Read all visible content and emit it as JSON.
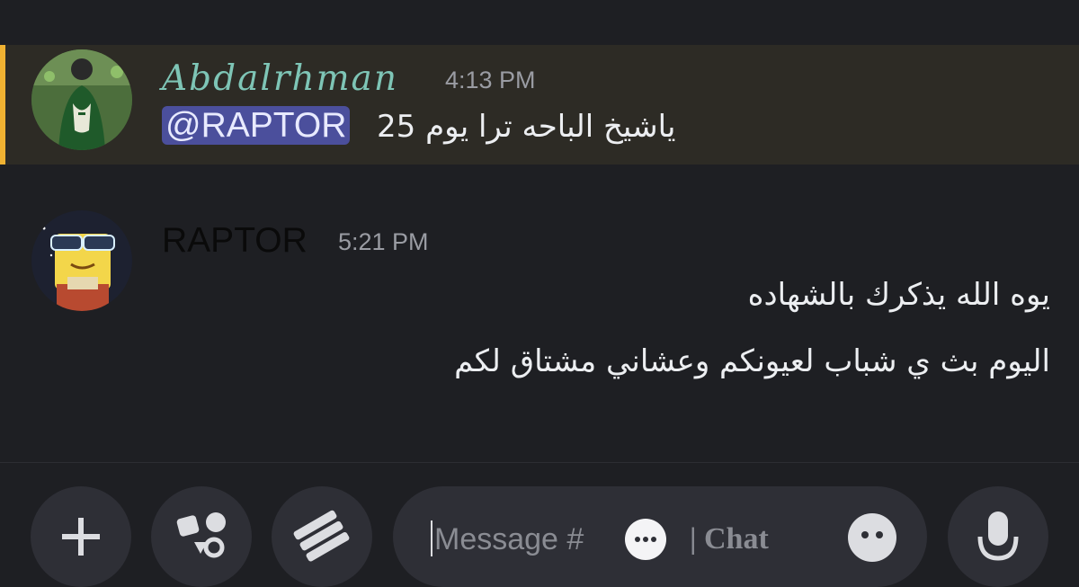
{
  "messages": [
    {
      "author": "Abdalrhman",
      "time": "4:13 PM",
      "mention": "@RAPTOR",
      "text": "ياشيخ الباحه ترا يوم 25",
      "highlighted": true
    },
    {
      "author": "RAPTOR",
      "time": "5:21 PM",
      "lines": [
        "يوه الله يذكرك بالشهاده",
        "اليوم بث ي شباب لعيونكم وعشاني مشتاق لكم"
      ]
    }
  ],
  "composer": {
    "placeholder": "Message #",
    "channel": "| Chat"
  },
  "colors": {
    "background": "#1e1f23",
    "highlight": "#2d2b25",
    "highlight_bar": "#f0b232",
    "mention_bg": "#4b4f9c",
    "author1": "#7ec5b6"
  },
  "icons": [
    "plus-icon",
    "apps-icon",
    "gift-icon",
    "emoji-icon",
    "microphone-icon",
    "speech-bubble-icon"
  ]
}
